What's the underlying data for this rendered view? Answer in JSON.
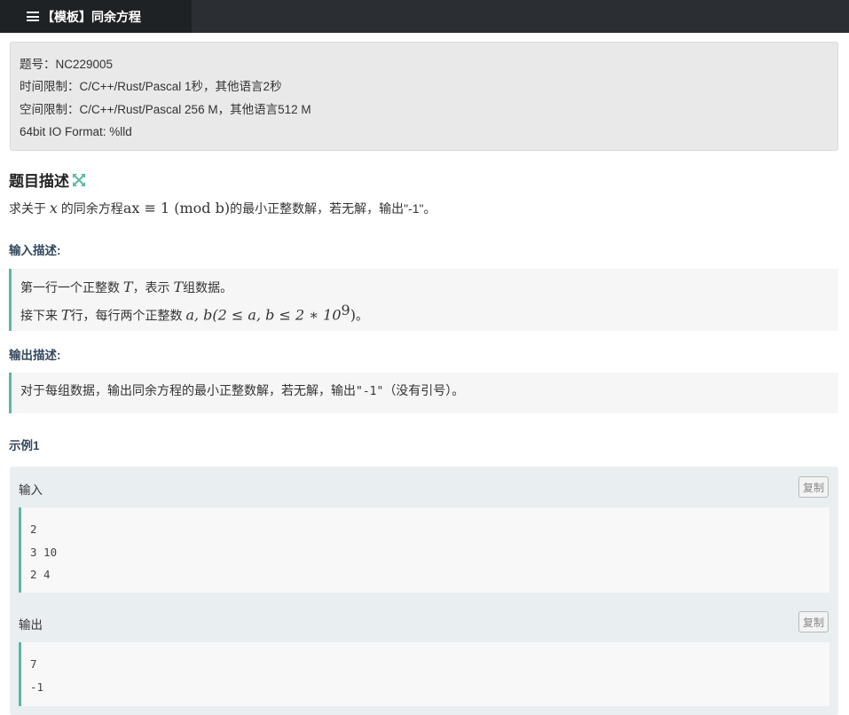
{
  "tab": {
    "title": "【模板】同余方程"
  },
  "meta": {
    "problem_id": "题号：NC229005",
    "time_limit": "时间限制：C/C++/Rust/Pascal 1秒，其他语言2秒",
    "memory_limit": "空间限制：C/C++/Rust/Pascal 256 M，其他语言512 M",
    "io_format": "64bit IO Format: %lld"
  },
  "description": {
    "heading": "题目描述",
    "text_prefix": "求关于 ",
    "var_x": "x",
    "text_mid": " 的同余方程",
    "equation": "ax ≡ 1 (mod b)",
    "text_suffix": "的最小正整数解，若无解，输出\"-1\"。"
  },
  "input_section": {
    "heading": "输入描述:",
    "line1_a": "第一行一个正整数 ",
    "line1_var": "T",
    "line1_b": "，表示 ",
    "line1_var2": "T",
    "line1_c": "组数据。",
    "line2_a": "接下来 ",
    "line2_var": "T",
    "line2_b": "行，每行两个正整数 ",
    "line2_math": "a, b(2 ≤ a, b ≤ 2 ∗ 10",
    "line2_exp": "9",
    "line2_close": ")",
    "line2_end": "。"
  },
  "output_section": {
    "heading": "输出描述:",
    "text_a": "对于每组数据，输出同余方程的最小正整数解，若无解，输出",
    "code": "\"-1\"",
    "text_b": "（没有引号）。"
  },
  "example": {
    "heading": "示例1",
    "input_label": "输入",
    "output_label": "输出",
    "copy_label": "复制",
    "input_lines": [
      "2",
      "3 10",
      "2 4"
    ],
    "output_lines": [
      "7",
      "-1"
    ]
  },
  "colors": {
    "accent": "#5bb9a3",
    "topbar": "#2b2f33"
  }
}
